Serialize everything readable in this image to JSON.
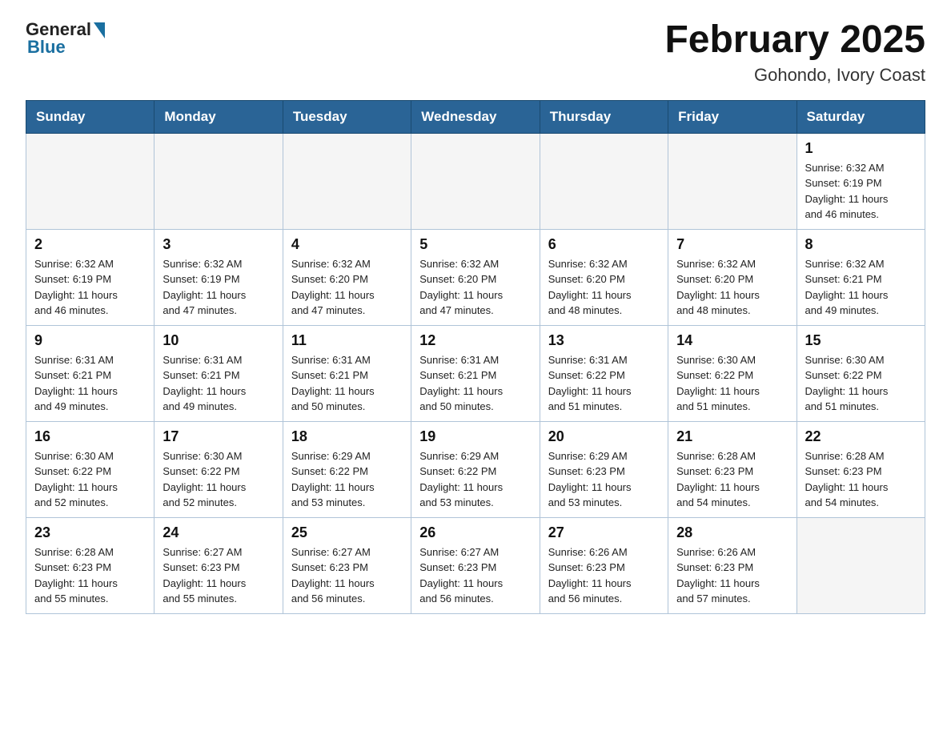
{
  "header": {
    "logo_general": "General",
    "logo_blue": "Blue",
    "title": "February 2025",
    "location": "Gohondo, Ivory Coast"
  },
  "days_of_week": [
    "Sunday",
    "Monday",
    "Tuesday",
    "Wednesday",
    "Thursday",
    "Friday",
    "Saturday"
  ],
  "weeks": [
    [
      {
        "day": "",
        "info": ""
      },
      {
        "day": "",
        "info": ""
      },
      {
        "day": "",
        "info": ""
      },
      {
        "day": "",
        "info": ""
      },
      {
        "day": "",
        "info": ""
      },
      {
        "day": "",
        "info": ""
      },
      {
        "day": "1",
        "info": "Sunrise: 6:32 AM\nSunset: 6:19 PM\nDaylight: 11 hours\nand 46 minutes."
      }
    ],
    [
      {
        "day": "2",
        "info": "Sunrise: 6:32 AM\nSunset: 6:19 PM\nDaylight: 11 hours\nand 46 minutes."
      },
      {
        "day": "3",
        "info": "Sunrise: 6:32 AM\nSunset: 6:19 PM\nDaylight: 11 hours\nand 47 minutes."
      },
      {
        "day": "4",
        "info": "Sunrise: 6:32 AM\nSunset: 6:20 PM\nDaylight: 11 hours\nand 47 minutes."
      },
      {
        "day": "5",
        "info": "Sunrise: 6:32 AM\nSunset: 6:20 PM\nDaylight: 11 hours\nand 47 minutes."
      },
      {
        "day": "6",
        "info": "Sunrise: 6:32 AM\nSunset: 6:20 PM\nDaylight: 11 hours\nand 48 minutes."
      },
      {
        "day": "7",
        "info": "Sunrise: 6:32 AM\nSunset: 6:20 PM\nDaylight: 11 hours\nand 48 minutes."
      },
      {
        "day": "8",
        "info": "Sunrise: 6:32 AM\nSunset: 6:21 PM\nDaylight: 11 hours\nand 49 minutes."
      }
    ],
    [
      {
        "day": "9",
        "info": "Sunrise: 6:31 AM\nSunset: 6:21 PM\nDaylight: 11 hours\nand 49 minutes."
      },
      {
        "day": "10",
        "info": "Sunrise: 6:31 AM\nSunset: 6:21 PM\nDaylight: 11 hours\nand 49 minutes."
      },
      {
        "day": "11",
        "info": "Sunrise: 6:31 AM\nSunset: 6:21 PM\nDaylight: 11 hours\nand 50 minutes."
      },
      {
        "day": "12",
        "info": "Sunrise: 6:31 AM\nSunset: 6:21 PM\nDaylight: 11 hours\nand 50 minutes."
      },
      {
        "day": "13",
        "info": "Sunrise: 6:31 AM\nSunset: 6:22 PM\nDaylight: 11 hours\nand 51 minutes."
      },
      {
        "day": "14",
        "info": "Sunrise: 6:30 AM\nSunset: 6:22 PM\nDaylight: 11 hours\nand 51 minutes."
      },
      {
        "day": "15",
        "info": "Sunrise: 6:30 AM\nSunset: 6:22 PM\nDaylight: 11 hours\nand 51 minutes."
      }
    ],
    [
      {
        "day": "16",
        "info": "Sunrise: 6:30 AM\nSunset: 6:22 PM\nDaylight: 11 hours\nand 52 minutes."
      },
      {
        "day": "17",
        "info": "Sunrise: 6:30 AM\nSunset: 6:22 PM\nDaylight: 11 hours\nand 52 minutes."
      },
      {
        "day": "18",
        "info": "Sunrise: 6:29 AM\nSunset: 6:22 PM\nDaylight: 11 hours\nand 53 minutes."
      },
      {
        "day": "19",
        "info": "Sunrise: 6:29 AM\nSunset: 6:22 PM\nDaylight: 11 hours\nand 53 minutes."
      },
      {
        "day": "20",
        "info": "Sunrise: 6:29 AM\nSunset: 6:23 PM\nDaylight: 11 hours\nand 53 minutes."
      },
      {
        "day": "21",
        "info": "Sunrise: 6:28 AM\nSunset: 6:23 PM\nDaylight: 11 hours\nand 54 minutes."
      },
      {
        "day": "22",
        "info": "Sunrise: 6:28 AM\nSunset: 6:23 PM\nDaylight: 11 hours\nand 54 minutes."
      }
    ],
    [
      {
        "day": "23",
        "info": "Sunrise: 6:28 AM\nSunset: 6:23 PM\nDaylight: 11 hours\nand 55 minutes."
      },
      {
        "day": "24",
        "info": "Sunrise: 6:27 AM\nSunset: 6:23 PM\nDaylight: 11 hours\nand 55 minutes."
      },
      {
        "day": "25",
        "info": "Sunrise: 6:27 AM\nSunset: 6:23 PM\nDaylight: 11 hours\nand 56 minutes."
      },
      {
        "day": "26",
        "info": "Sunrise: 6:27 AM\nSunset: 6:23 PM\nDaylight: 11 hours\nand 56 minutes."
      },
      {
        "day": "27",
        "info": "Sunrise: 6:26 AM\nSunset: 6:23 PM\nDaylight: 11 hours\nand 56 minutes."
      },
      {
        "day": "28",
        "info": "Sunrise: 6:26 AM\nSunset: 6:23 PM\nDaylight: 11 hours\nand 57 minutes."
      },
      {
        "day": "",
        "info": ""
      }
    ]
  ]
}
